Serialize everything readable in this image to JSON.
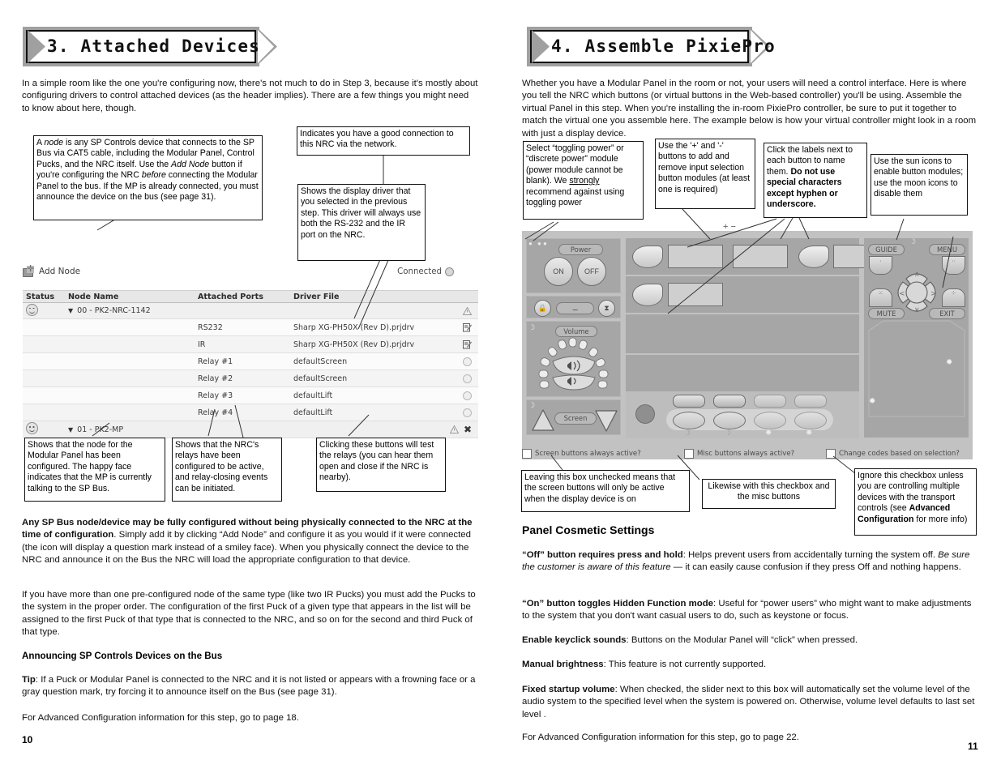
{
  "left_page": {
    "banner_title": "3. Attached Devices",
    "intro": "In a simple room like the one you're configuring now, there's not much to do in Step 3, because it's mostly about configuring drivers to control attached devices (as the header implies). There are a few things you might need to know about here, though.",
    "callouts": {
      "node_def": "A node is any SP Controls device that connects to the SP Bus via CAT5 cable, including the Modular Panel, Control Pucks, and the NRC itself. Use the Add Node button if you're configuring the NRC before connecting the Modular Panel to the bus. If the MP is already connected, you must announce the device on the bus (see page 31).",
      "good_connection": "Indicates you have a good connection to this NRC via the network.",
      "display_driver": "Shows the display driver that you selected in the previous step. This driver will always use both the RS-232 and the IR port on the NRC.",
      "mp_node": "Shows that the node for the Modular Panel has been configured. The happy face indicates that the MP is currently talking to the SP Bus.",
      "relays": "Shows that the NRC's relays have been configured to be active, and relay-closing events can be initiated.",
      "test_relays": "Clicking these buttons will test the relays (you can hear them open and close if the NRC is nearby)."
    },
    "app": {
      "add_node_label": "Add Node",
      "connected_label": "Connected",
      "columns": [
        "Status",
        "Node Name",
        "Attached Ports",
        "Driver File"
      ],
      "rows": [
        {
          "type": "group",
          "status": "smiley",
          "name": "00 - PK2-NRC-1142",
          "ports": "",
          "driver": "",
          "action": "warn"
        },
        {
          "type": "child",
          "status": "",
          "name": "",
          "ports": "RS232",
          "driver": "Sharp XG-PH50X (Rev D).prjdrv",
          "action": "edit"
        },
        {
          "type": "child",
          "status": "",
          "name": "",
          "ports": "IR",
          "driver": "Sharp XG-PH50X (Rev D).prjdrv",
          "action": "edit"
        },
        {
          "type": "child",
          "status": "",
          "name": "",
          "ports": "Relay #1",
          "driver": "defaultScreen",
          "action": "relay"
        },
        {
          "type": "child",
          "status": "",
          "name": "",
          "ports": "Relay #2",
          "driver": "defaultScreen",
          "action": "relay"
        },
        {
          "type": "child",
          "status": "",
          "name": "",
          "ports": "Relay #3",
          "driver": "defaultLift",
          "action": "relay"
        },
        {
          "type": "child",
          "status": "",
          "name": "",
          "ports": "Relay #4",
          "driver": "defaultLift",
          "action": "relay"
        },
        {
          "type": "group",
          "status": "smiley",
          "name": "01 - PK2-MP",
          "ports": "",
          "driver": "",
          "action": "warn-x"
        }
      ]
    },
    "body": {
      "para_bold_lead": "Any SP Bus node/device may be fully configured without being physically connected to the NRC at the time of configuration",
      "para1_rest": ". Simply add it by clicking “Add Node” and configure it as you would if it were connected (the icon will display a question mark instead of a smiley face). When you physically connect the device to the NRC and announce it on the Bus the NRC will load the appropriate configuration to that device.",
      "para2": "If you have more than one pre-configured node of the same type (like two IR Pucks) you must add the Pucks to the system in the proper order. The configuration of the first Puck of a given type that appears in the list will be assigned to the first Puck of that type that is connected to the NRC, and so on for the second and third Puck of that type.",
      "heading": "Announcing SP Controls Devices on the Bus",
      "tip_lead": "Tip",
      "tip_rest": ": If a Puck or Modular Panel is connected to the NRC and it is not listed or appears with a frowning face or a gray question mark, try forcing it to announce itself on the Bus (see page 31).",
      "advanced": "For Advanced Configuration information for this step, go to page 18."
    },
    "page_number": "10"
  },
  "right_page": {
    "banner_title": "4. Assemble PixiePro",
    "intro": "Whether you have a Modular Panel in the room or not, your users will need a control interface. Here is where you tell the NRC which buttons (or virtual buttons in the Web-based controller) you'll be using. Assemble the virtual Panel in this step. When you're installing the in-room PixiePro controller, be sure to put it together to match the virtual one you assemble here. The example below is how your virtual controller might look in a room with just a display device.",
    "callouts": {
      "power_module": "Select “toggling power” or “discrete power” module (power module cannot be blank). We strongly recommend against using toggling power",
      "plus_minus": "Use the '+' and '-' buttons to add and remove input selection button modules (at least one is required)",
      "labels": "Click the labels next to each button to name them. Do not use special characters except hyphen or underscore.",
      "sun_moon": "Use the sun icons to enable button modules; use the moon icons to disable them",
      "screen_cb": "Leaving this box unchecked means that the screen buttons will only be active when the display device is on",
      "misc_cb": "Likewise with this checkbox and the misc buttons",
      "codes_cb": "Ignore this checkbox unless you are controlling multiple devices with the transport controls (see Advanced Configuration for more info)"
    },
    "panel": {
      "plus_label": "+",
      "minus_label": "−",
      "power_label": "Power",
      "on_label": "ON",
      "off_label": "OFF",
      "volume_label": "Volume",
      "screen_label": "Screen",
      "guide_label": "GUIDE",
      "menu_label": "MENU",
      "mute_label": "MUTE",
      "exit_label": "EXIT"
    },
    "checkboxes": [
      {
        "label": "Screen buttons always active?",
        "checked": false
      },
      {
        "label": "Misc buttons always active?",
        "checked": false
      },
      {
        "label": "Change codes based on selection?",
        "checked": false
      }
    ],
    "section_heading": "Panel Cosmetic Settings",
    "settings": [
      {
        "lead": "“Off” button requires press and hold",
        "rest": ": Helps prevent users from accidentally turning the system off. ",
        "italic": "Be sure the customer is aware of this feature",
        "tail": " — it can easily cause confusion if they press Off and nothing happens."
      },
      {
        "lead": "“On” button toggles Hidden Function mode",
        "rest": ": Useful for “power users” who might want to make adjustments to the system that you don't want casual users to do, such as keystone or focus.",
        "italic": "",
        "tail": ""
      },
      {
        "lead": "Enable keyclick sounds",
        "rest": ": Buttons on the Modular Panel will “click” when pressed.",
        "italic": "",
        "tail": ""
      },
      {
        "lead": "Manual brightness",
        "rest": ": This feature is not currently supported.",
        "italic": "",
        "tail": ""
      },
      {
        "lead": "Fixed startup volume",
        "rest": ": When checked, the slider next to this box will automatically set the volume level of the audio system to the specified level when the system is powered on. Otherwise, volume level defaults to last set level   .",
        "italic": "",
        "tail": ""
      }
    ],
    "advanced": "For Advanced Configuration information for this step, go to page 22.",
    "page_number": "11"
  }
}
